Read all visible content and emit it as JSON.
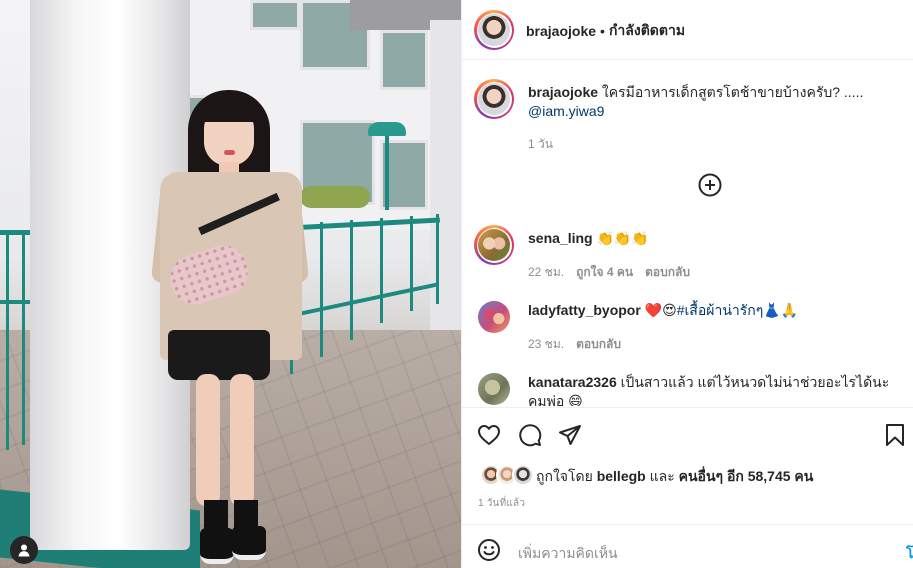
{
  "post": {
    "author": {
      "username": "brajaojoke",
      "separator": "•",
      "follow_status": "กำลังติดตาม"
    },
    "caption": {
      "username": "brajaojoke",
      "text": "ใครมีอาหารเด็กสูตรโตช้าขายบ้างครับ? .....",
      "mention": "@iam.yiwa9",
      "age": "1 วัน"
    },
    "comments": [
      {
        "username": "sena_ling",
        "text": "👏👏👏",
        "age": "22 ชม.",
        "likes": "ถูกใจ 4 คน",
        "reply": "ตอบกลับ"
      },
      {
        "username": "ladyfatty_byopor",
        "text_prefix": "❤️😍",
        "hashtag": "#เสื้อผ้าน่ารักๆ",
        "text_suffix": "👗🙏",
        "age": "23 ชม.",
        "reply": "ตอบกลับ"
      },
      {
        "username": "kanatara2326",
        "text": "เป็นสาวแล้ว แต่ไว้หนวดไม่น่าช่วยอะไรได้นะคุมพ่อ 😄"
      }
    ],
    "likes": {
      "prefix": "ถูกใจโดย",
      "first_user": "bellegb",
      "joiner": "และ",
      "others": "คนอื่นๆ อีก 58,745 คน"
    },
    "timestamp": "1 วันที่แล้ว",
    "comment_input": {
      "placeholder": "เพิ่มความคิดเห็น",
      "post_label": "โ"
    }
  },
  "icons": {
    "like": "heart-icon",
    "comment": "comment-bubble-icon",
    "share": "paper-plane-icon",
    "save": "bookmark-icon",
    "load_more": "plus-circle-icon",
    "emoji": "smiley-icon",
    "tag": "person-tag-icon"
  },
  "colors": {
    "text": "#262626",
    "secondary": "#8e8e8e",
    "link": "#00376b",
    "accent": "#0095f6",
    "border": "#efefef"
  }
}
